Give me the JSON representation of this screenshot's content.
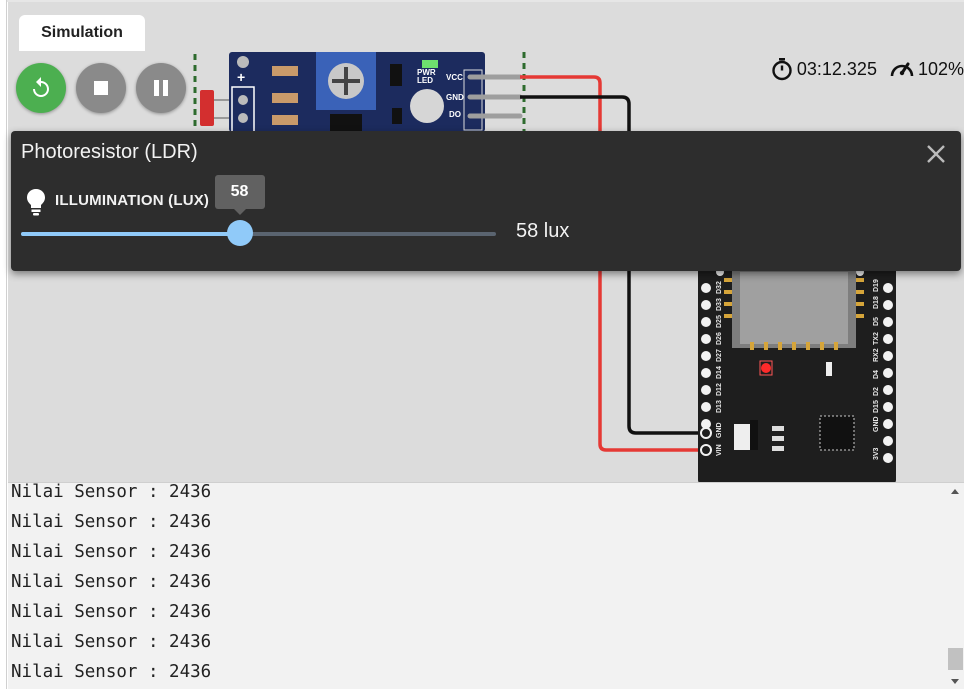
{
  "tab": {
    "label": "Simulation"
  },
  "controls": {
    "restart": "restart-icon",
    "stop": "stop-icon",
    "pause": "pause-icon"
  },
  "status": {
    "timer": "03:12.325",
    "speed": "102%"
  },
  "sensor_module": {
    "plus_label": "+",
    "pins": [
      "VCC",
      "GND",
      "DO"
    ],
    "pwr_led_label_1": "PWR",
    "pwr_led_label_2": "LED",
    "do_led_label": "DO"
  },
  "board": {
    "left_pins": [
      "D32",
      "D33",
      "D25",
      "D26",
      "D27",
      "D14",
      "D12",
      "D13",
      "GND",
      "VIN"
    ],
    "right_pins": [
      "D2",
      "D19",
      "D18",
      "D5",
      "TX2",
      "RX2",
      "D4",
      "D2",
      "D15",
      "GND",
      "3V3"
    ]
  },
  "panel": {
    "title": "Photoresistor (LDR)",
    "slider_label": "ILLUMINATION (LUX)",
    "slider_value": 58,
    "slider_tooltip": "58",
    "value_text": "58 lux",
    "slider_fraction": 0.46
  },
  "serial": {
    "lines": [
      "Nilai Sensor : 2436",
      "Nilai Sensor : 2436",
      "Nilai Sensor : 2436",
      "Nilai Sensor : 2436",
      "Nilai Sensor : 2436",
      "Nilai Sensor : 2436",
      "Nilai Sensor : 2436"
    ]
  },
  "colors": {
    "restart_btn": "#4caf50",
    "control_btn": "#8a8a8a",
    "wire_red": "#e53935",
    "wire_black": "#111111",
    "board": "#1e1e1e",
    "sensor_pcb": "#1c2b5e",
    "slider_accent": "#90caf9",
    "panel_bg": "#2d2d2d"
  }
}
